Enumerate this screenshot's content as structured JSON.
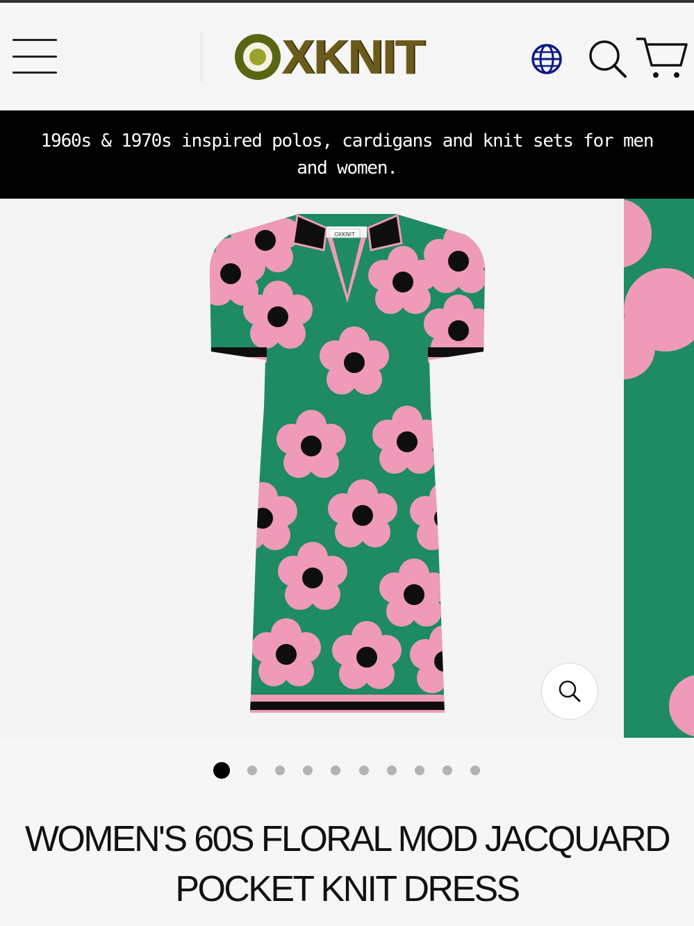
{
  "brand": {
    "logo_text": "XKNIT",
    "logo_alt": "OXKNIT"
  },
  "header": {
    "menu_icon": "hamburger-menu-icon",
    "globe_icon": "globe-icon",
    "search_icon": "search-icon",
    "cart_icon": "cart-icon"
  },
  "announcement": {
    "text": "1960s & 1970s inspired polos, cardigans and knit sets for men and women."
  },
  "gallery": {
    "collar_label": "OXKNIT",
    "zoom_icon": "zoom-icon",
    "slide_count": 10,
    "active_slide": 1
  },
  "product": {
    "title_line1": "WOMEN'S 60S FLORAL MOD JACQUARD",
    "title_line2": "POCKET KNIT DRESS"
  },
  "colors": {
    "dress_green": "#1e8b63",
    "flower_pink": "#ef9ab8",
    "trim_black": "#0e0e0e",
    "logo_olive": "#5a6514"
  }
}
